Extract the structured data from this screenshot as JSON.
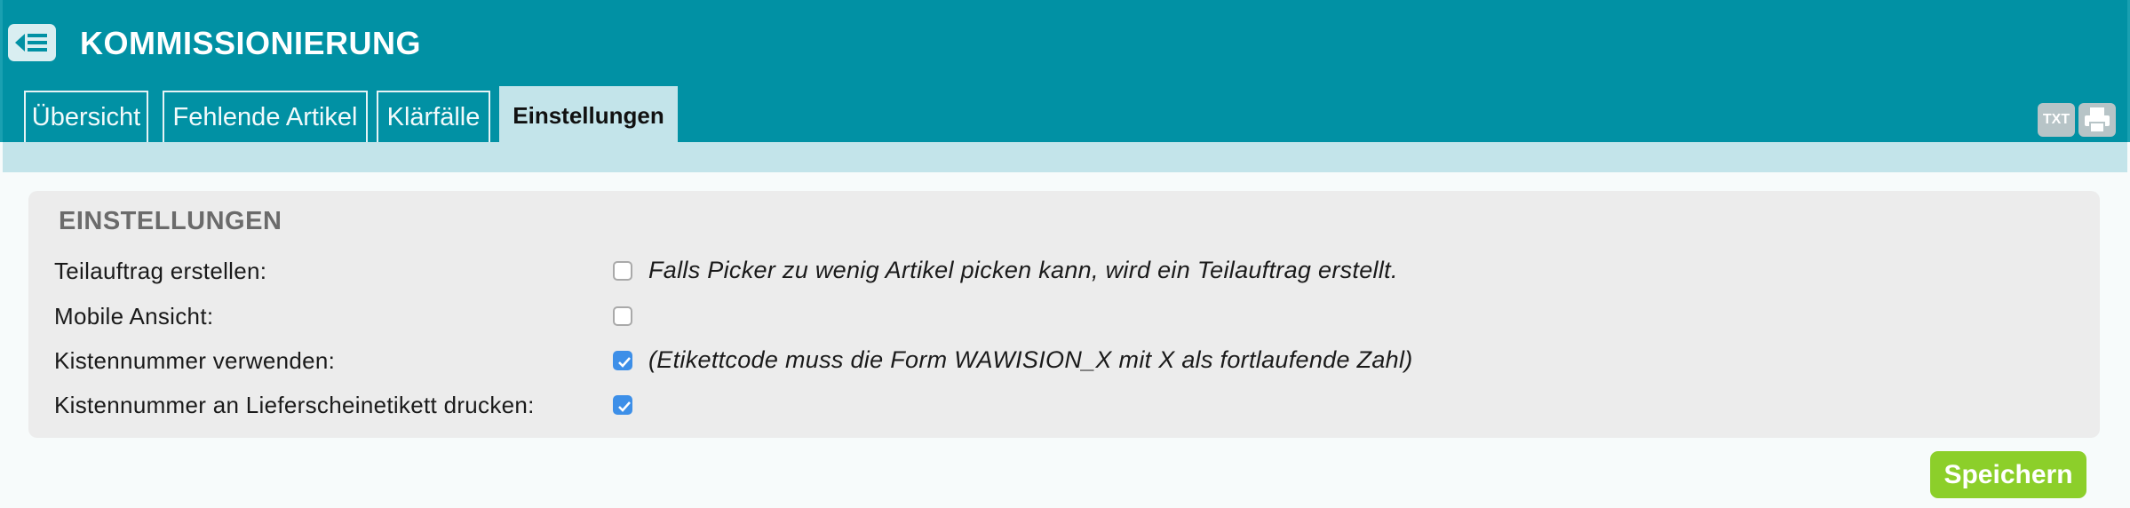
{
  "header": {
    "title": "KOMMISSIONIERUNG"
  },
  "tabs": [
    {
      "label": "Übersicht",
      "active": false
    },
    {
      "label": "Fehlende Artikel",
      "active": false
    },
    {
      "label": "Klärfälle",
      "active": false
    },
    {
      "label": "Einstellungen",
      "active": true
    }
  ],
  "toolbar": {
    "txt_label": "TXT",
    "print_icon": "printer-icon"
  },
  "settings": {
    "title": "EINSTELLUNGEN",
    "rows": [
      {
        "label": "Teilauftrag erstellen:",
        "checked": false,
        "hint": "Falls Picker zu wenig Artikel picken kann, wird ein Teilauftrag erstellt."
      },
      {
        "label": "Mobile Ansicht:",
        "checked": false,
        "hint": ""
      },
      {
        "label": "Kistennummer verwenden:",
        "checked": true,
        "hint": "(Etikettcode muss die Form WAWISION_X mit X als fortlaufende Zahl)"
      },
      {
        "label": "Kistennummer an Lieferscheinetikett drucken:",
        "checked": true,
        "hint": ""
      }
    ]
  },
  "actions": {
    "save_label": "Speichern"
  },
  "colors": {
    "header": "#0191a4",
    "subbar": "#c3e4ea",
    "panel": "#ececec",
    "save": "#8ccf2a",
    "checkbox_on": "#3d8fe8"
  }
}
